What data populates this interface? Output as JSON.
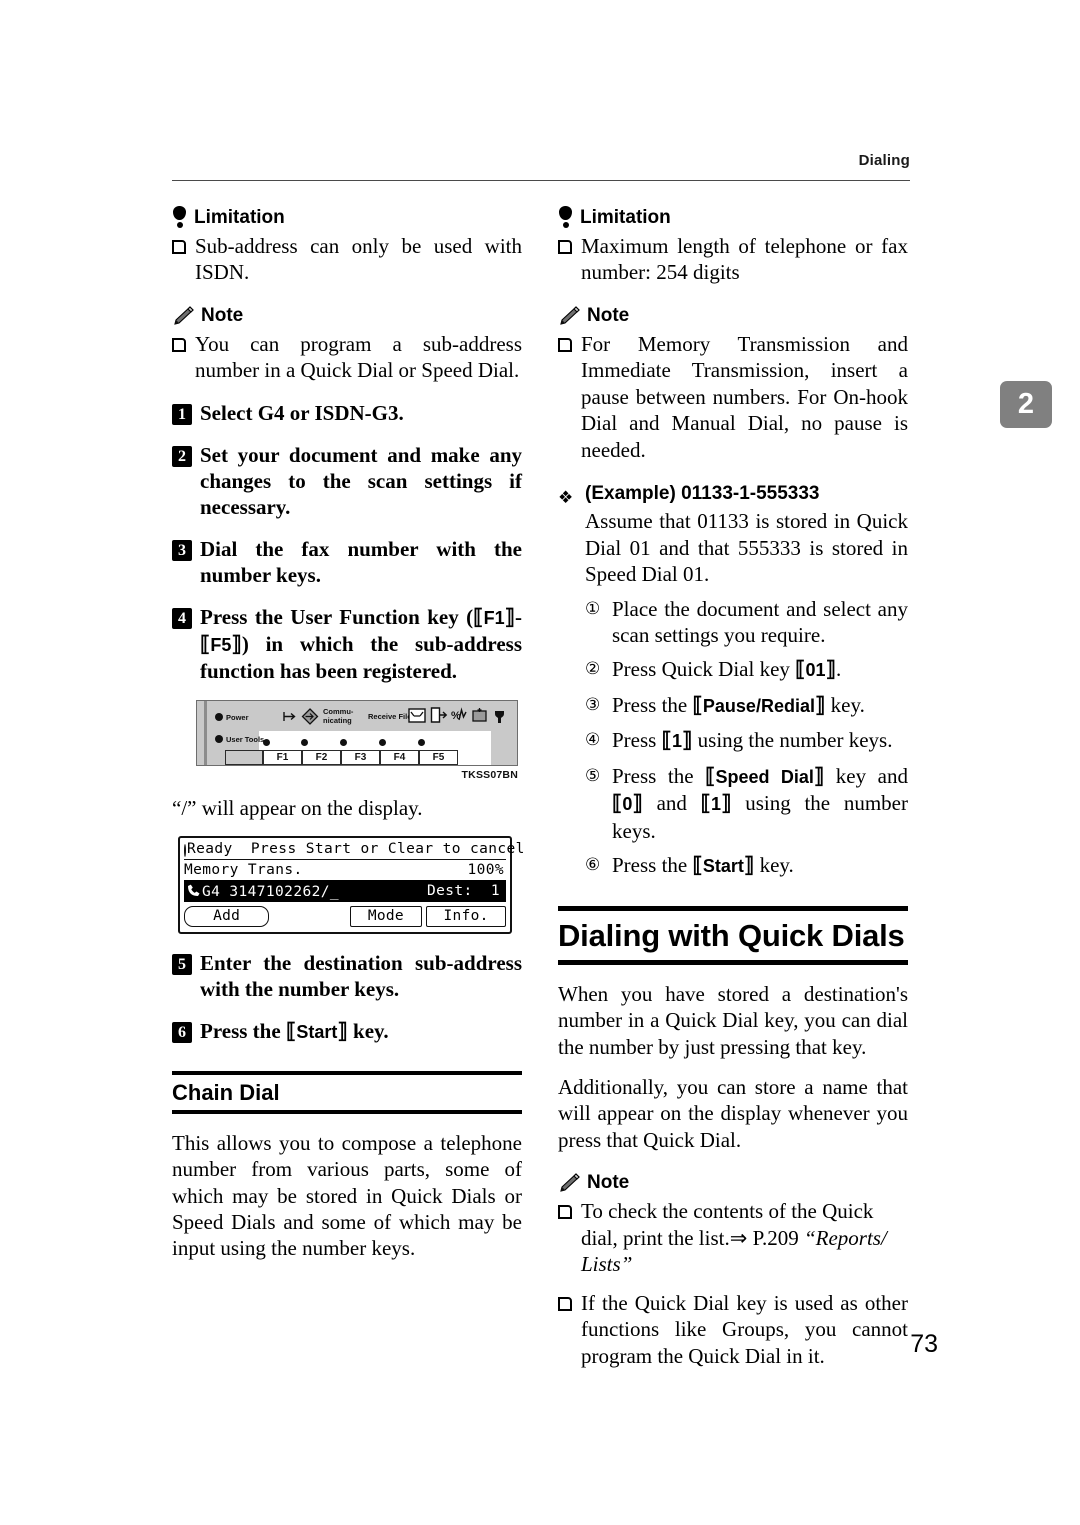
{
  "page": {
    "running_header": "Dialing",
    "chapter_tab": "2",
    "folio": "73"
  },
  "left_column": {
    "limitation_heading": "Limitation",
    "limitation_items": [
      "Sub-address can only be used with ISDN."
    ],
    "note_heading": "Note",
    "note_items": [
      "You can program a sub-address number in a Quick Dial or Speed Dial."
    ],
    "steps": [
      {
        "num": "1",
        "text": "Select G4 or ISDN-G3."
      },
      {
        "num": "2",
        "text": "Set your document and make any changes to the scan settings if necessary."
      },
      {
        "num": "3",
        "text": "Dial the fax number with the number keys."
      },
      {
        "num": "4",
        "text_before": "Press the User Function key (",
        "key_a": "F1",
        "dash": "-",
        "key_b": "F5",
        "text_after": ") in which the sub-address function has been registered."
      },
      {
        "num": "5",
        "text": "Enter the destination sub-address with the number keys."
      },
      {
        "num": "6",
        "text_before": "Press the ",
        "key": "Start",
        "text_after": " key."
      }
    ],
    "panel_figure": {
      "power_label": "Power",
      "user_tools_label": "User Tools",
      "communicating_label_line1": "Commu-",
      "communicating_label_line2": "nicating",
      "receive_file_label": "Receive File",
      "function_keys": [
        "F1",
        "F2",
        "F3",
        "F4",
        "F5"
      ],
      "caption": "TKSS07BN"
    },
    "display_caption": "“/” will appear on the display.",
    "lcd_figure": {
      "status": "Ready",
      "prompt": "Press Start or Clear to cancel",
      "mode": "Memory Trans.",
      "memory_pct": "100%",
      "line_type": "G4",
      "number": "3147102262/_",
      "dest_label": "Dest:",
      "dest_count": "1",
      "buttons": [
        "Add",
        "Mode",
        "Info."
      ]
    },
    "section_chain_dial": {
      "title": "Chain Dial",
      "body": "This allows you to compose a telephone number from various parts, some of which may be stored in Quick Dials or Speed Dials and some of which may be input using the number keys."
    }
  },
  "right_column": {
    "limitation_heading": "Limitation",
    "limitation_items": [
      "Maximum length of telephone or fax number: 254 digits"
    ],
    "note_heading": "Note",
    "note_items": [
      "For Memory Transmission and Immediate Transmission, insert a pause between numbers. For On-hook Dial and Manual Dial, no pause is needed."
    ],
    "example": {
      "label": "(Example)",
      "value": "01133-1-555333",
      "body": "Assume that 01133 is stored in Quick Dial 01 and that 555333 is stored in Speed Dial 01.",
      "substeps": [
        {
          "num": "①",
          "text": "Place the document and select any scan settings you require."
        },
        {
          "num": "②",
          "text_before": "Press Quick Dial key ",
          "key": "01",
          "text_after": "."
        },
        {
          "num": "③",
          "text_before": "Press the ",
          "key": "Pause/Redial",
          "text_after": " key."
        },
        {
          "num": "④",
          "text_before": "Press ",
          "key": "1",
          "text_after": " using the number keys."
        },
        {
          "num": "⑤",
          "text_before": "Press the ",
          "key": "Speed Dial",
          "text_mid": " key and ",
          "key2": "0",
          "text_mid2": " and ",
          "key3": "1",
          "text_after": " using the number keys."
        },
        {
          "num": "⑥",
          "text_before": "Press the ",
          "key": "Start",
          "text_after": " key."
        }
      ]
    },
    "section_quick_dials": {
      "title": "Dialing with Quick Dials",
      "paragraph1": "When you have stored a destination's number in a Quick Dial key, you can dial the number by just pressing that key.",
      "paragraph2": "Additionally, you can store a name that will appear on the display whenever you press that Quick Dial.",
      "note_heading": "Note",
      "note_items": [
        {
          "pre": "To check the contents of the Quick dial, print the list.",
          "arrow": "⇒",
          "ref": " P.209 ",
          "quoted_italic": "“Reports/ Lists”"
        },
        {
          "plain": "If the Quick Dial key is used as other functions like Groups, you cannot program the Quick Dial in it."
        }
      ]
    }
  }
}
